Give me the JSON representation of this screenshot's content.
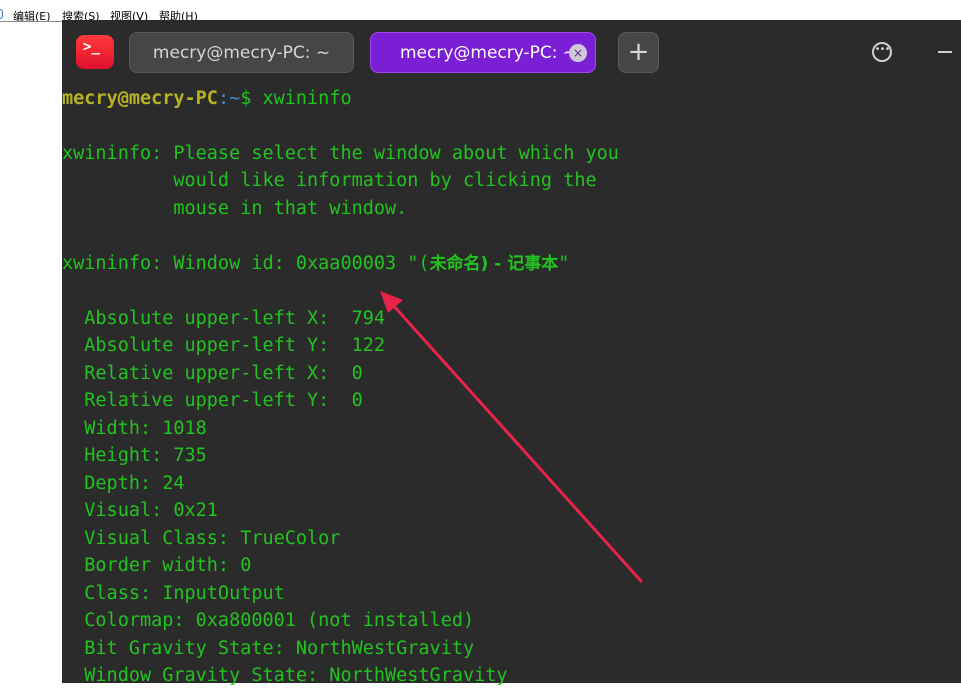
{
  "notepad_menu": [
    "编辑(E)",
    "搜索(S)",
    "视图(V)",
    "帮助(H)"
  ],
  "terminal": {
    "app_icon_glyph": ">_",
    "tabs": [
      {
        "label": "mecry@mecry-PC: ~",
        "active": false
      },
      {
        "label": "mecry@mecry-PC: ~",
        "active": true
      }
    ],
    "close_glyph": "×",
    "add_tab_glyph": "+",
    "more_glyph": "•••",
    "prompt": {
      "user_host": "mecry@mecry-PC",
      "path": ":~",
      "symbol": "$",
      "command": " xwininfo"
    },
    "lines": [
      "xwininfo: Please select the window about which you",
      "          would like information by clicking the",
      "          mouse in that window.",
      "xwininfo: Window id: 0xaa00003 \"(",
      "  Absolute upper-left X:  794",
      "  Absolute upper-left Y:  122",
      "  Relative upper-left X:  0",
      "  Relative upper-left Y:  0",
      "  Width: 1018",
      "  Height: 735",
      "  Depth: 24",
      "  Visual: 0x21",
      "  Visual Class: TrueColor",
      "  Border width: 0",
      "  Class: InputOutput",
      "  Colormap: 0xa800001 (not installed)",
      "  Bit Gravity State: NorthWestGravity",
      "  Window Gravity State: NorthWestGravity"
    ],
    "window_title_cjk": "未命名) - 记事本",
    "window_title_end": "\""
  },
  "colors": {
    "terminal_bg": "#2b2b2b",
    "text_green": "#22c31f",
    "prompt_user": "#b7b322",
    "prompt_path": "#3d8fd0",
    "active_tab": "#7a1fd6",
    "annotation_arrow": "#e8234a"
  },
  "icons": [
    "terminal-app-icon",
    "tab-close-icon",
    "add-tab-icon",
    "more-options-icon",
    "minimize-icon"
  ]
}
